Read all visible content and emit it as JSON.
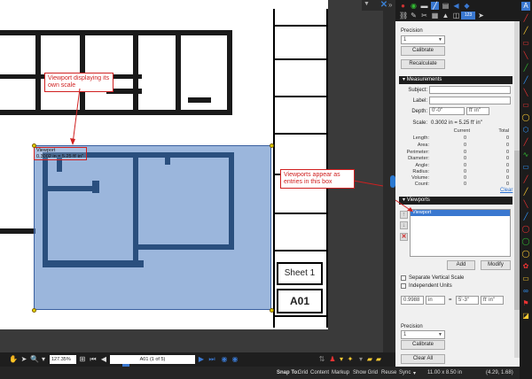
{
  "canvas": {
    "viewport_label": "Viewport",
    "viewport_scale": "0.3002 in = 5.25 ft' in\"",
    "sheet_label": "Sheet 1",
    "sheet_number": "A01"
  },
  "callouts": {
    "viewport_callout": "Viewport displaying its own scale",
    "entries_callout": "Viewports appear as entries in this box"
  },
  "panel": {
    "precision_label": "Precision",
    "precision_value": "1",
    "calibrate_label": "Calibrate",
    "recalculate_label": "Recalculate",
    "measurements_header": "Measurements",
    "subject_label": "Subject:",
    "label_label": "Label:",
    "depth_label": "Depth:",
    "depth_value": "0'-0\"",
    "depth_unit": "ft' in\"",
    "scale_label": "Scale:",
    "scale_value": "0.3002 in = 5.25 ft' in\"",
    "current_header": "Current",
    "total_header": "Total",
    "measurements": [
      {
        "name": "Length:",
        "current": "0",
        "total": "0"
      },
      {
        "name": "Area:",
        "current": "0",
        "total": "0"
      },
      {
        "name": "Perimeter:",
        "current": "0",
        "total": "0"
      },
      {
        "name": "Diameter:",
        "current": "0",
        "total": "0"
      },
      {
        "name": "Angle:",
        "current": "0",
        "total": "0"
      },
      {
        "name": "Radius:",
        "current": "0",
        "total": "0"
      },
      {
        "name": "Volume:",
        "current": "0",
        "total": "0"
      },
      {
        "name": "Count:",
        "current": "0",
        "total": "0"
      }
    ],
    "clear_link": "Clear",
    "viewports_header": "Viewports",
    "viewport_entry": "Viewport",
    "add_label": "Add",
    "modify_label": "Modify",
    "separate_vertical_label": "Separate Vertical Scale",
    "independent_units_label": "Independent Units",
    "scale_in_value": "0.9988",
    "scale_in_unit": "in",
    "scale_equals": "=",
    "scale_out_value": "5'-3\"",
    "scale_out_unit": "ft' in\"",
    "precision2_label": "Precision",
    "precision2_value": "1",
    "calibrate2_label": "Calibrate",
    "clear_all_label": "Clear All",
    "toolbar_badge": "123"
  },
  "bottom": {
    "zoom": "127.35%",
    "page": "A01 (1 of 5)"
  },
  "status": {
    "snap_to": "Snap To:",
    "grid": "Grid",
    "content": "Content",
    "markup": "Markup",
    "show_grid": "Show Grid",
    "reuse": "Reuse",
    "sync": "Sync",
    "page_size": "11.00 x 8.50 in",
    "coords": "(4.29, 1.68)"
  },
  "colors": {
    "accent": "#3a78d0",
    "callout": "#d02020",
    "viewport_fill": "#6d9bd4"
  }
}
